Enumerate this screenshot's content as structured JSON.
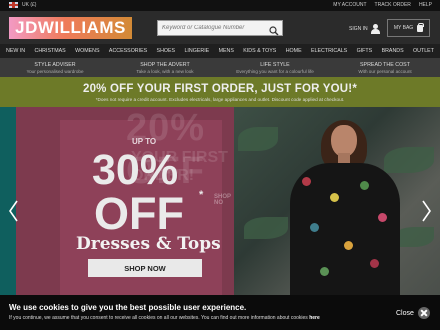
{
  "topbar": {
    "locale": "UK (£)",
    "links": [
      "MY ACCOUNT",
      "TRACK ORDER",
      "HELP"
    ]
  },
  "header": {
    "logo": "JDWILLIAMS",
    "search_placeholder": "Keyword or Catalogue Number",
    "signin": "SIGN IN",
    "mybag": "MY BAG",
    "bag_count": "0"
  },
  "nav": {
    "items": [
      "NEW IN",
      "CHRISTMAS",
      "WOMENS",
      "ACCESSORIES",
      "SHOES",
      "LINGERIE",
      "MENS",
      "KIDS & TOYS",
      "HOME",
      "ELECTRICALS",
      "GIFTS",
      "BRANDS",
      "OUTLET"
    ]
  },
  "services": [
    {
      "title": "STYLE ADVISER",
      "sub": "Your personalised wardrobe"
    },
    {
      "title": "SHOP THE ADVERT",
      "sub": "Take a look, with a new look"
    },
    {
      "title": "LIFE STYLE",
      "sub": "Everything you want for a colourful life"
    },
    {
      "title": "SPREAD THE COST",
      "sub": "With our personal account"
    }
  ],
  "promo": {
    "title": "20% OFF YOUR FIRST ORDER, JUST FOR YOU!*",
    "small": "*Does not require a credit account. Excludes electricals, large appliances and outlet. Discount code applied at checkout."
  },
  "hero": {
    "ghost_big": "20% OFF",
    "ghost_small": "YOUR FIRST ORDER!",
    "upto": "UP TO",
    "percent": "30%",
    "off": "OFF",
    "star": "*",
    "category": "Dresses & Tops",
    "cta": "SHOP NOW",
    "ghost_shop": "SHOP NO"
  },
  "cookie": {
    "title": "We use cookies to give you the best possible user experience.",
    "text": "If you continue, we assume that you consent to receive all cookies on all our websites. You can find out more information about cookies",
    "link": "here",
    "close": "Close"
  },
  "colors": {
    "header_bg": "#2b2b2b",
    "promo_bg": "#6d7a28",
    "hero_pink": "#8e4159",
    "hero_teal": "#0f5f5e",
    "cookie_bg": "#0b0b0b"
  }
}
